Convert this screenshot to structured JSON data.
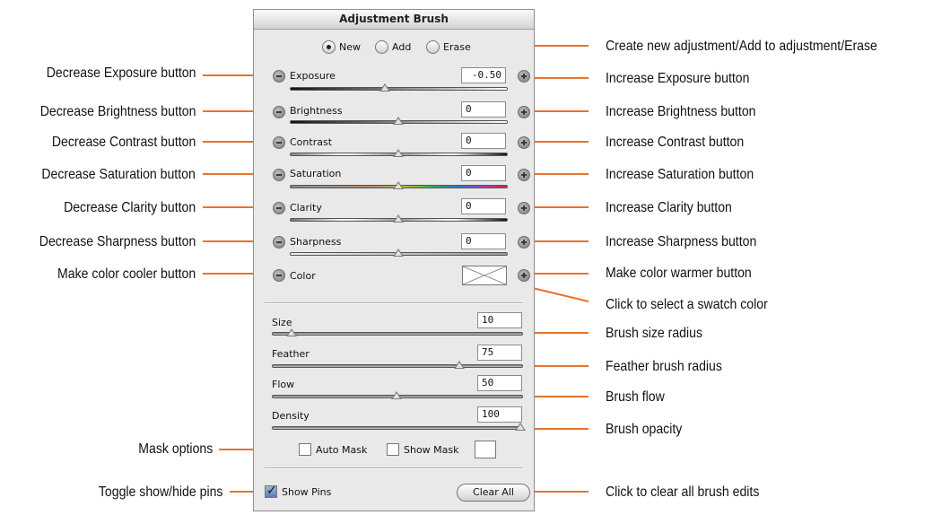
{
  "panel": {
    "title": "Adjustment Brush",
    "mode": {
      "options": [
        "New",
        "Add",
        "Erase"
      ],
      "selected": "New"
    },
    "sliders": [
      {
        "label": "Exposure",
        "value": "-0.50",
        "track": "exposure",
        "position": 0.38
      },
      {
        "label": "Brightness",
        "value": "0",
        "track": "brightness",
        "position": 0.5
      },
      {
        "label": "Contrast",
        "value": "0",
        "track": "contrast",
        "position": 0.5
      },
      {
        "label": "Saturation",
        "value": "0",
        "track": "saturation",
        "position": 0.5
      },
      {
        "label": "Clarity",
        "value": "0",
        "track": "clarity",
        "position": 0.5
      },
      {
        "label": "Sharpness",
        "value": "0",
        "track": "sharpness",
        "position": 0.5
      }
    ],
    "color_label": "Color",
    "brush": [
      {
        "label": "Size",
        "value": "10",
        "position": 0.08
      },
      {
        "label": "Feather",
        "value": "75",
        "position": 0.75
      },
      {
        "label": "Flow",
        "value": "50",
        "position": 0.5
      },
      {
        "label": "Density",
        "value": "100",
        "position": 1.0
      }
    ],
    "auto_mask": {
      "label": "Auto Mask",
      "checked": false
    },
    "show_mask": {
      "label": "Show Mask",
      "checked": false
    },
    "show_pins": {
      "label": "Show Pins",
      "checked": true
    },
    "clear_all": "Clear All"
  },
  "callouts_left": [
    "Decrease Exposure button",
    "Decrease Brightness button",
    "Decrease Contrast button",
    "Decrease Saturation button",
    "Decrease Clarity button",
    "Decrease Sharpness button",
    "Make color cooler button",
    "Mask options",
    "Toggle show/hide pins"
  ],
  "callouts_right": [
    "Create new adjustment/Add to adjustment/Erase",
    "Increase Exposure button",
    "Increase Brightness button",
    "Increase Contrast button",
    "Increase Saturation button",
    "Increase Clarity button",
    "Increase Sharpness button",
    "Make color warmer button",
    "Click to select a swatch color",
    "Brush size radius",
    "Feather brush radius",
    "Brush flow",
    "Brush opacity",
    "Click to clear all brush edits"
  ],
  "colors": {
    "leader": "#e8732a",
    "panel_bg": "#e9e9e9"
  }
}
